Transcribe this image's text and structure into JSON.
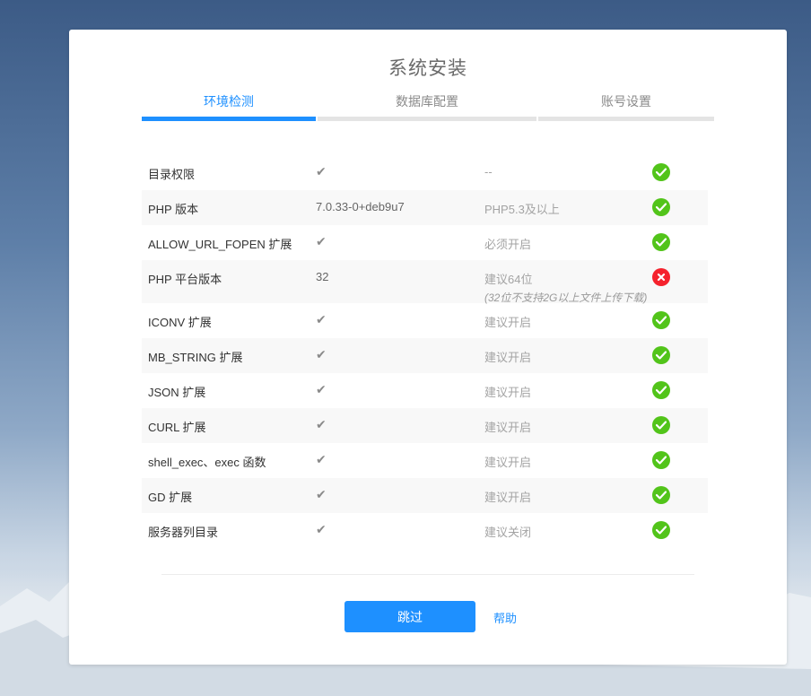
{
  "page": {
    "title": "系统安装"
  },
  "steps": [
    {
      "label": "环境检测",
      "active": true
    },
    {
      "label": "数据库配置",
      "active": false
    },
    {
      "label": "账号设置",
      "active": false
    }
  ],
  "check_icon": "check-icon",
  "rows": [
    {
      "name": "目录权限",
      "current": "✔",
      "required": "--",
      "note": "",
      "status": "ok"
    },
    {
      "name": "PHP 版本",
      "current": "7.0.33-0+deb9u7",
      "required": "PHP5.3及以上",
      "note": "",
      "status": "ok"
    },
    {
      "name": "ALLOW_URL_FOPEN 扩展",
      "current": "✔",
      "required": "必须开启",
      "note": "",
      "status": "ok"
    },
    {
      "name": "PHP 平台版本",
      "current": "32",
      "required": "建议64位",
      "note": "(32位不支持2G以上文件上传下载)",
      "status": "error"
    },
    {
      "name": "ICONV 扩展",
      "current": "✔",
      "required": "建议开启",
      "note": "",
      "status": "ok"
    },
    {
      "name": "MB_STRING 扩展",
      "current": "✔",
      "required": "建议开启",
      "note": "",
      "status": "ok"
    },
    {
      "name": "JSON 扩展",
      "current": "✔",
      "required": "建议开启",
      "note": "",
      "status": "ok"
    },
    {
      "name": "CURL 扩展",
      "current": "✔",
      "required": "建议开启",
      "note": "",
      "status": "ok"
    },
    {
      "name": "shell_exec、exec 函数",
      "current": "✔",
      "required": "建议开启",
      "note": "",
      "status": "ok"
    },
    {
      "name": "GD 扩展",
      "current": "✔",
      "required": "建议开启",
      "note": "",
      "status": "ok"
    },
    {
      "name": "服务器列目录",
      "current": "✔",
      "required": "建议关闭",
      "note": "",
      "status": "ok"
    }
  ],
  "actions": {
    "skip_label": "跳过",
    "help_label": "帮助"
  },
  "colors": {
    "accent": "#1e90ff",
    "ok": "#52c41a",
    "error": "#f5222d"
  }
}
